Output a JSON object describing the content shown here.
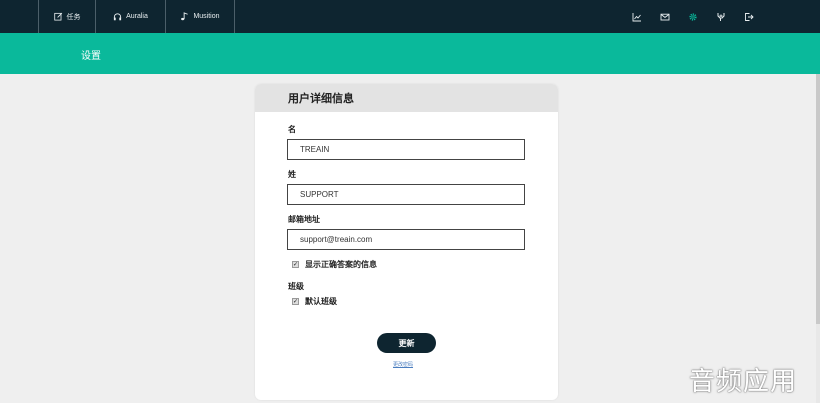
{
  "nav": {
    "tabs": [
      {
        "label": "任务",
        "icon": "edit-icon"
      },
      {
        "label": "Auralia",
        "icon": "headphones-icon"
      },
      {
        "label": "Musition",
        "icon": "note-icon"
      }
    ],
    "icons": [
      "chart-icon",
      "mail-icon",
      "gear-icon",
      "tools-icon",
      "logout-icon"
    ]
  },
  "banner": {
    "title": "设置"
  },
  "card": {
    "title": "用户详细信息",
    "first_name": {
      "label": "名",
      "value": "TREAIN"
    },
    "last_name": {
      "label": "姓",
      "value": "SUPPORT"
    },
    "email": {
      "label": "邮箱地址",
      "value": "support@treain.com"
    },
    "show_correct": {
      "label": "显示正确答案的信息",
      "checked": true
    },
    "class_section": {
      "label": "班级"
    },
    "default_class": {
      "label": "默认班级",
      "checked": true
    },
    "update_button": "更新",
    "change_password_link": "更改密码"
  },
  "watermark": "音频应用",
  "colors": {
    "nav_bg": "#0e2530",
    "banner": "#0ab99b",
    "active_icon": "#0ab99b",
    "button": "#0e2530"
  }
}
